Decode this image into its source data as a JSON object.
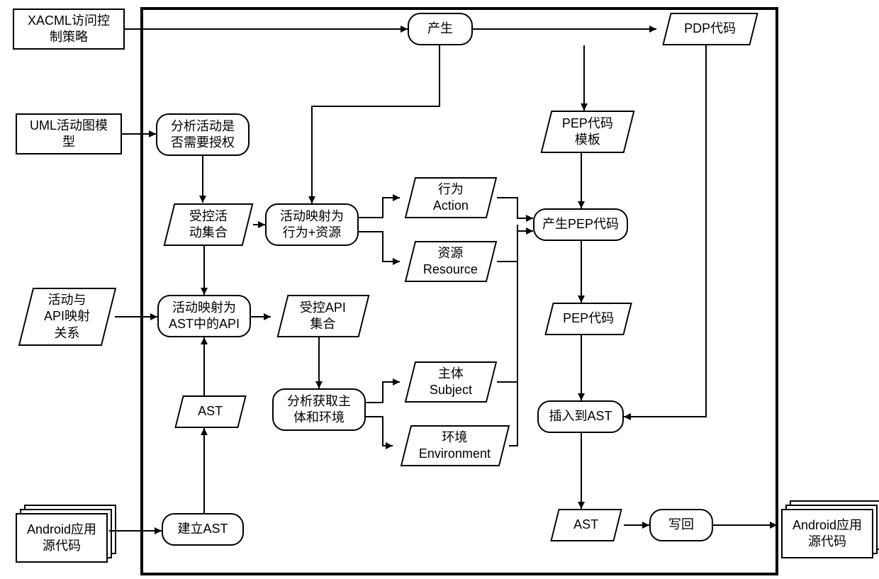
{
  "inputs": {
    "xacml": "XACML访问控\n制策略",
    "uml": "UML活动图模\n型",
    "mapping": "活动与\nAPI映射\n关系",
    "src_in": "Android应用\n源代码"
  },
  "processes": {
    "generate_pdp": "产生",
    "analyze_auth": "分析活动是\n否需要授权",
    "map_behavior": "活动映射为\n行为+资源",
    "map_ast_api": "活动映射为\nAST中的API",
    "analyze_subject": "分析获取主\n体和环境",
    "build_ast": "建立AST",
    "gen_pep": "产生PEP代码",
    "insert_ast": "插入到AST",
    "write_back": "写回"
  },
  "data": {
    "pdp_code": "PDP代码",
    "pep_template": "PEP代码\n模板",
    "controlled_activity": "受控活\n动集合",
    "action": "行为\nAction",
    "resource": "资源\nResource",
    "ast1": "AST",
    "controlled_api": "受控API\n集合",
    "subject": "主体\nSubject",
    "environment": "环境\nEnvironment",
    "pep_code": "PEP代码",
    "ast2": "AST"
  },
  "outputs": {
    "src_out": "Android应用\n源代码"
  }
}
